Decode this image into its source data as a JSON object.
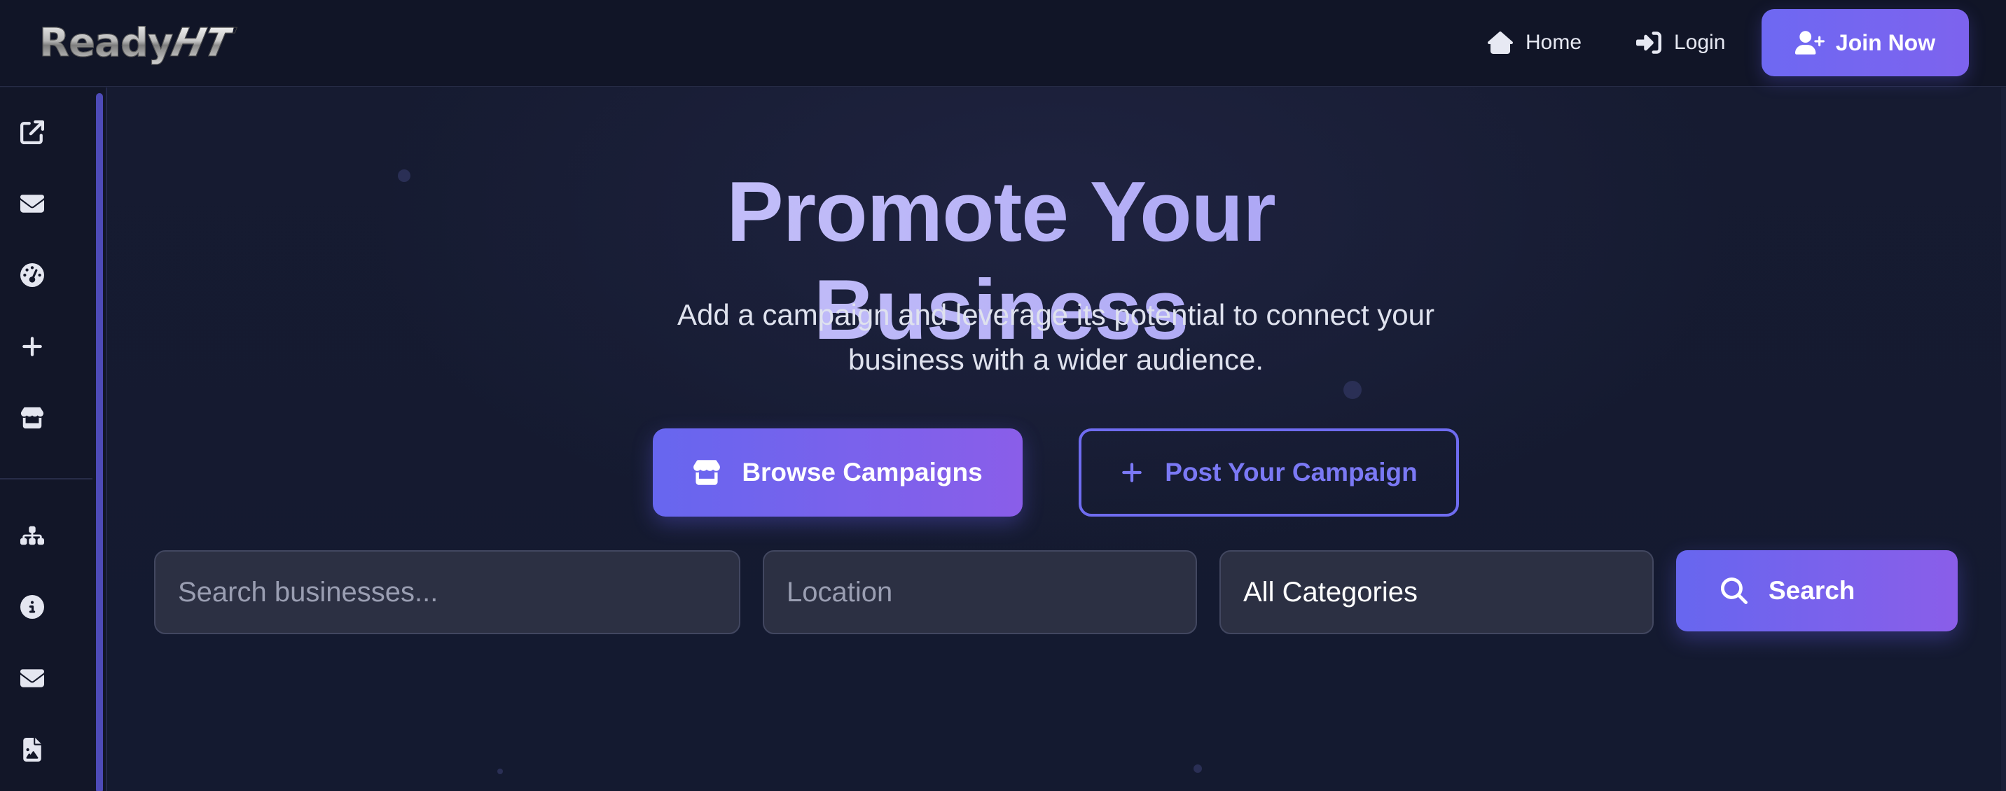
{
  "header": {
    "logo_ready": "Ready",
    "logo_ht": "HT",
    "nav_home": "Home",
    "nav_login": "Login",
    "join_button": "Join Now"
  },
  "sidebar": {
    "top_icons": [
      "external-link-icon",
      "envelope-icon",
      "dashboard-gauge-icon",
      "plus-icon",
      "store-icon"
    ],
    "bottom_icons": [
      "sitemap-icon",
      "info-icon",
      "envelope-icon",
      "file-image-icon"
    ]
  },
  "hero": {
    "title": "Promote Your Business",
    "subtitle_line1": "Add a campaign and leverage its potential to connect your",
    "subtitle_line2": "business with a wider audience.",
    "browse_button": "Browse Campaigns",
    "post_button": "Post Your Campaign"
  },
  "search": {
    "business_placeholder": "Search businesses...",
    "location_placeholder": "Location",
    "category_selected": "All Categories",
    "search_button": "Search"
  },
  "colors": {
    "background": "#151a30",
    "accent_start": "#6766ef",
    "accent_end": "#8a5ee9",
    "title_gradient_start": "#dcd9ff",
    "title_gradient_end": "#8a83ee"
  }
}
